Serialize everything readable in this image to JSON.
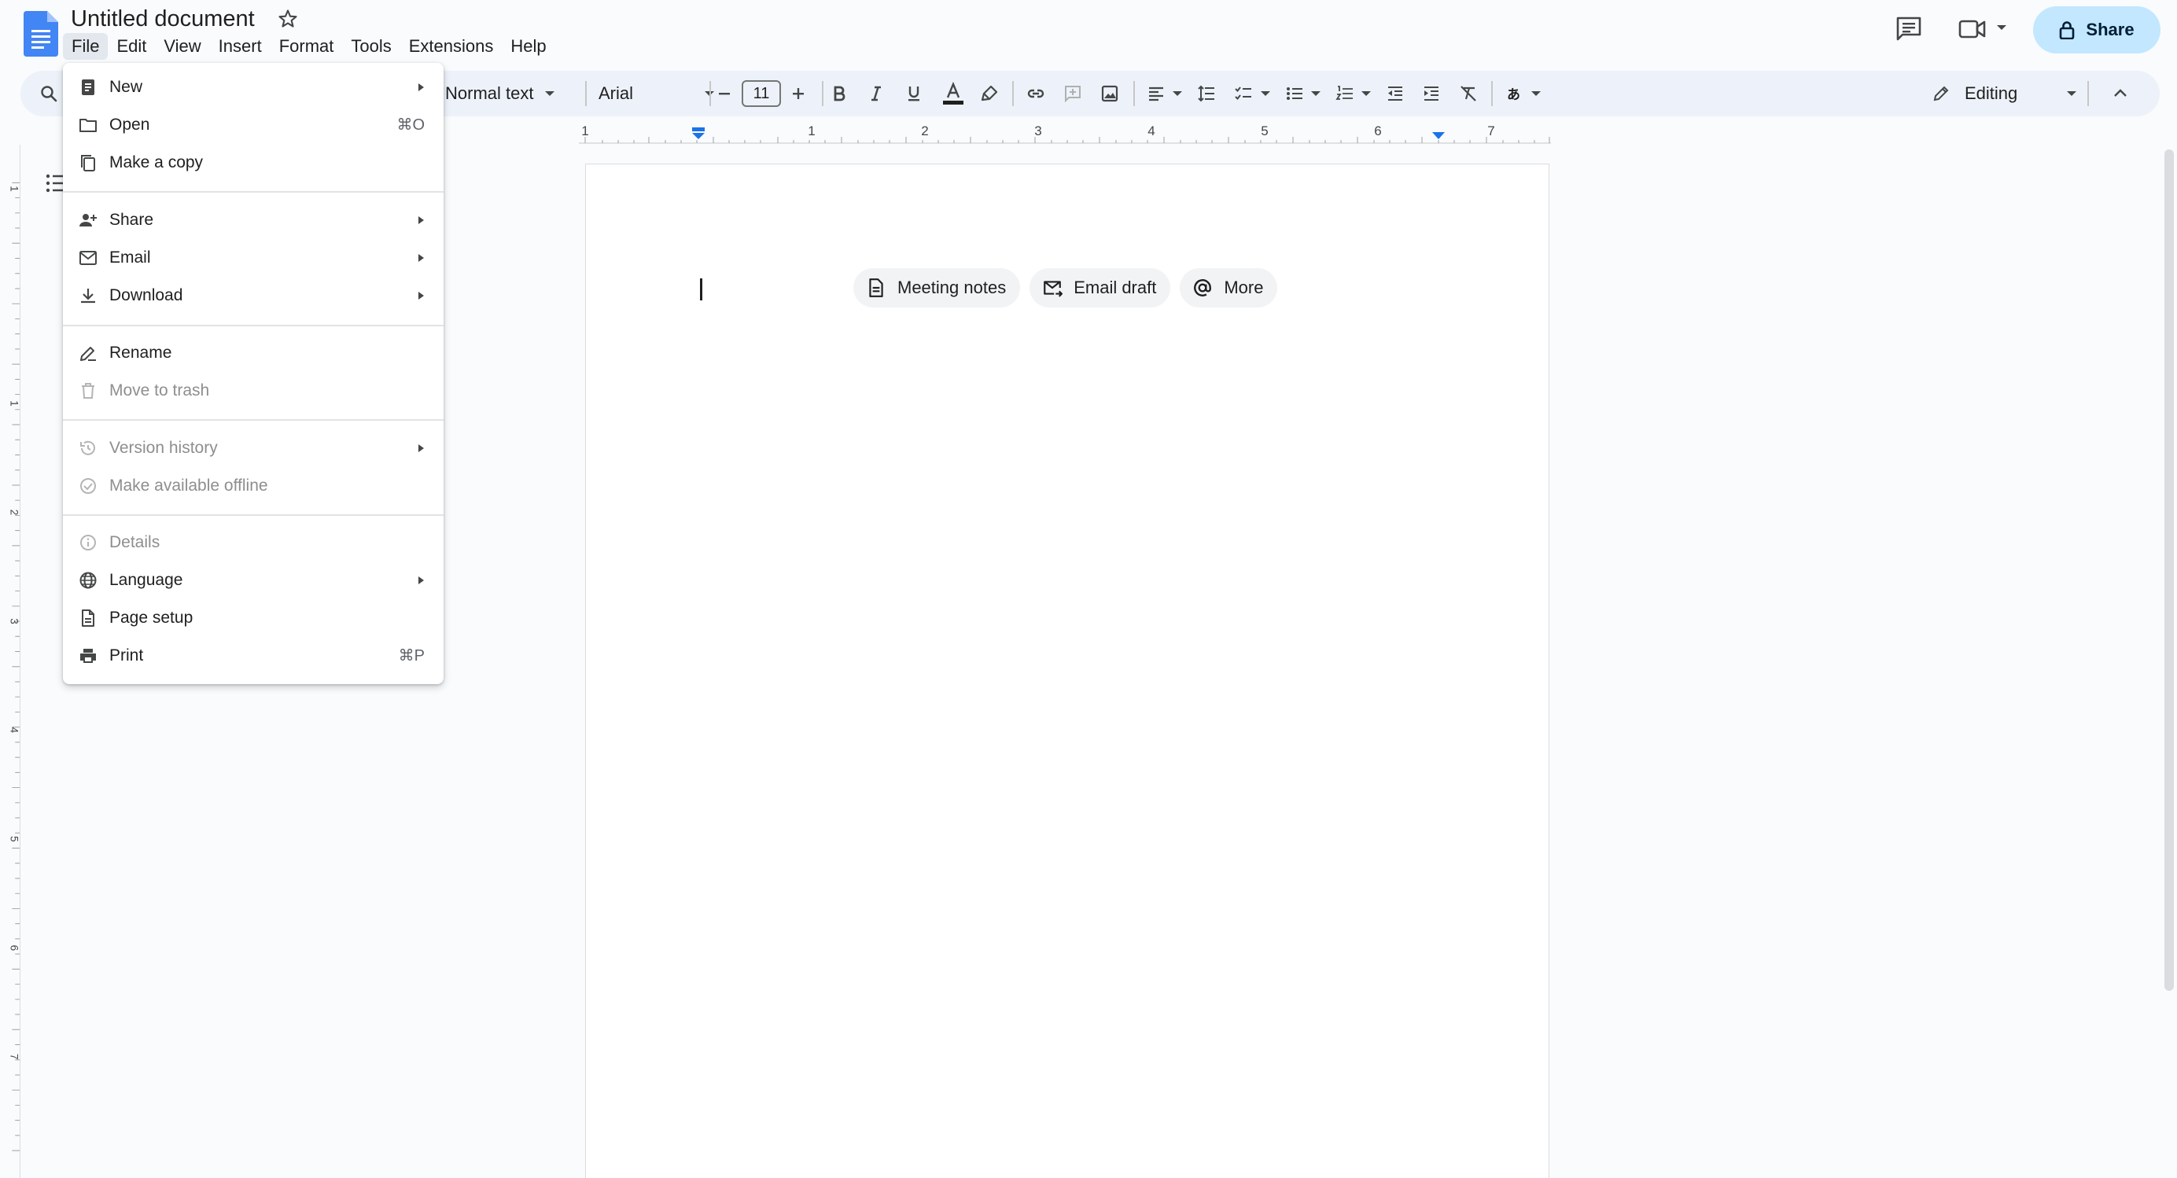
{
  "app": {
    "title": "Untitled document"
  },
  "menubar": [
    "File",
    "Edit",
    "View",
    "Insert",
    "Format",
    "Tools",
    "Extensions",
    "Help"
  ],
  "header": {
    "share_label": "Share"
  },
  "toolbar": {
    "style": "Normal text",
    "font": "Arial",
    "font_size": "11",
    "mode": "Editing"
  },
  "ruler": {
    "labels": [
      "1",
      "1",
      "2",
      "3",
      "4",
      "5",
      "6",
      "7"
    ],
    "vertical_labels": [
      "1",
      "1",
      "2",
      "3",
      "4",
      "5",
      "6",
      "7"
    ]
  },
  "document": {
    "chips": [
      {
        "label": "Meeting notes",
        "icon": "doc-icon"
      },
      {
        "label": "Email draft",
        "icon": "mail-send-icon"
      },
      {
        "label": "More",
        "icon": "at-icon"
      }
    ]
  },
  "file_menu": {
    "items": [
      {
        "label": "New",
        "icon": "new-doc-icon",
        "submenu": true,
        "disabled": false
      },
      {
        "label": "Open",
        "icon": "folder-icon",
        "shortcut": "⌘O",
        "disabled": false
      },
      {
        "label": "Make a copy",
        "icon": "copy-icon",
        "disabled": false
      },
      {
        "label": "Share",
        "icon": "person-add-icon",
        "submenu": true,
        "disabled": false
      },
      {
        "label": "Email",
        "icon": "mail-icon",
        "submenu": true,
        "disabled": false
      },
      {
        "label": "Download",
        "icon": "download-icon",
        "submenu": true,
        "disabled": false
      },
      {
        "label": "Rename",
        "icon": "rename-icon",
        "disabled": false
      },
      {
        "label": "Move to trash",
        "icon": "trash-icon",
        "disabled": true
      },
      {
        "label": "Version history",
        "icon": "history-icon",
        "submenu": true,
        "disabled": true
      },
      {
        "label": "Make available offline",
        "icon": "offline-icon",
        "disabled": true
      },
      {
        "label": "Details",
        "icon": "info-icon",
        "disabled": true
      },
      {
        "label": "Language",
        "icon": "globe-icon",
        "submenu": true,
        "disabled": false
      },
      {
        "label": "Page setup",
        "icon": "page-setup-icon",
        "disabled": false
      },
      {
        "label": "Print",
        "icon": "print-icon",
        "shortcut": "⌘P",
        "disabled": false
      }
    ]
  },
  "colors": {
    "accent": "#0b57d0",
    "share_bg": "#c2e7ff",
    "toolbar_bg": "#edf2fa",
    "page_bg": "#f9fbfd",
    "logo_blue": "#4285f4"
  }
}
